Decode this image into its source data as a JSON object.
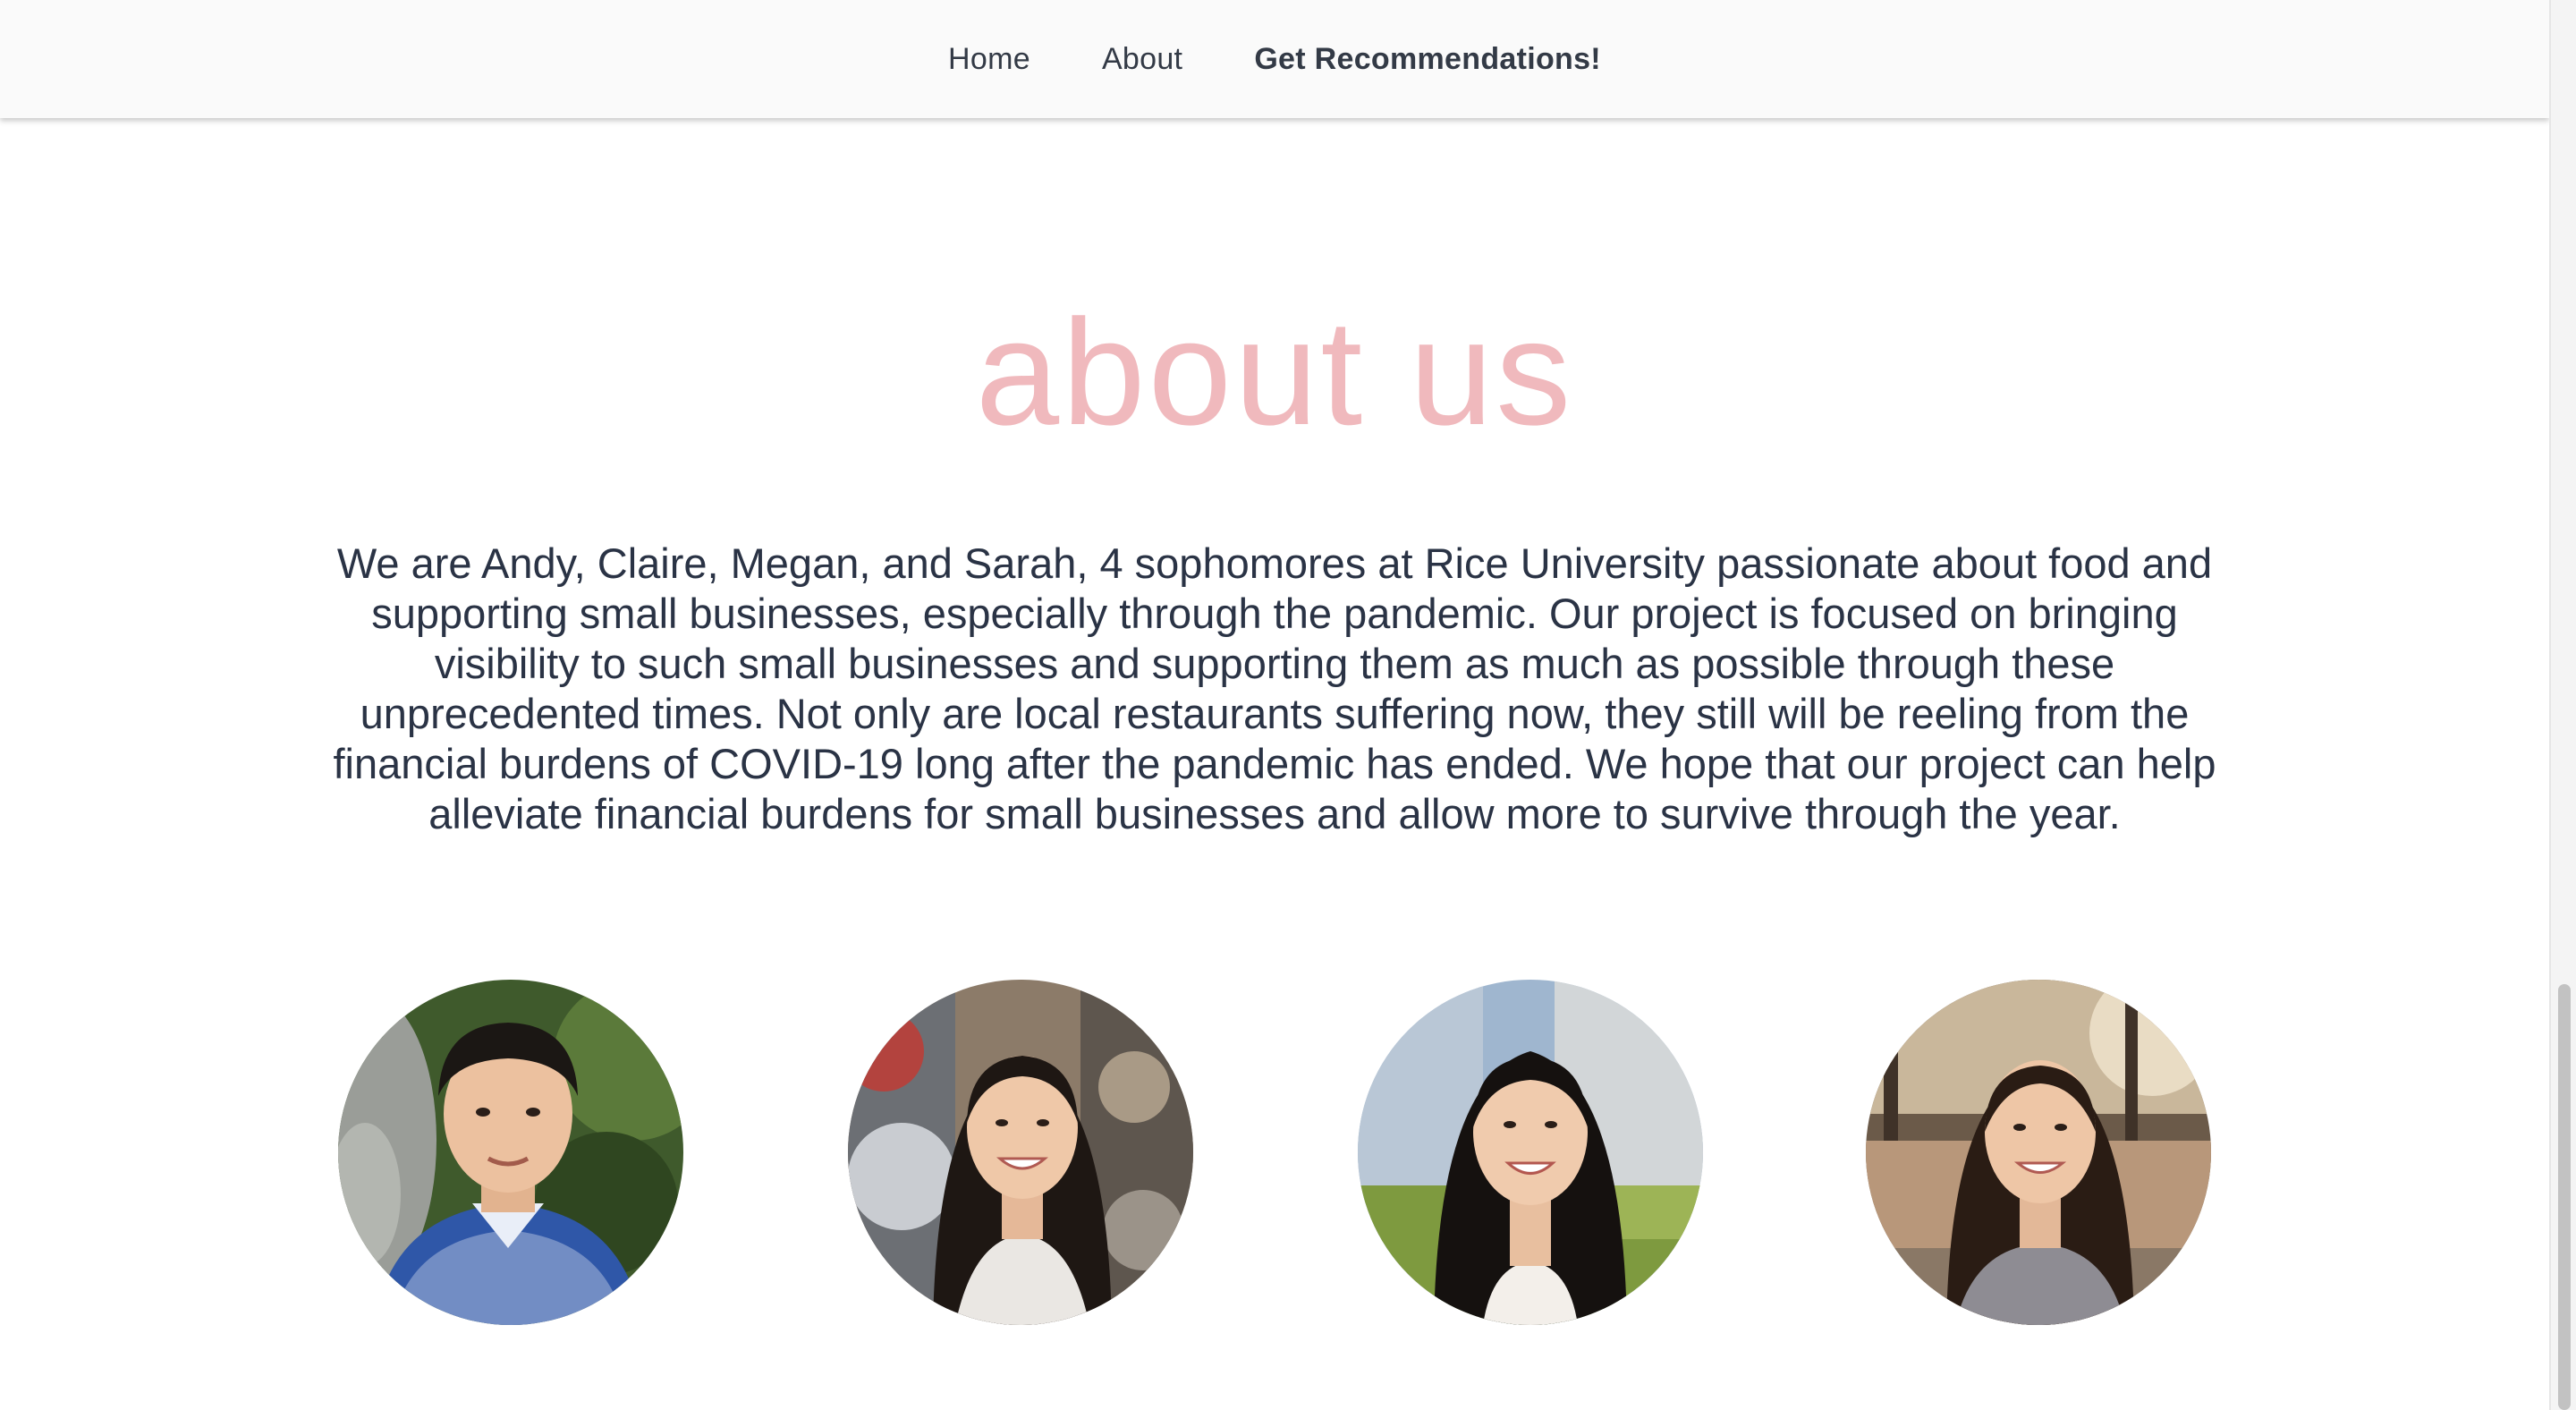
{
  "nav": {
    "home_label": "Home",
    "about_label": "About",
    "recommend_label": "Get Recommendations!"
  },
  "about": {
    "title": "about us",
    "description": "We are Andy, Claire, Megan, and Sarah, 4 sophomores at Rice University passionate about food and supporting small businesses, especially through the pandemic. Our project is focused on bringing visibility to such small businesses and supporting them as much as possible through these unprecedented times. Not only are local restaurants suffering now, they still will be reeling from the financial burdens of COVID-19 long after the pandemic has ended. We hope that our project can help alleviate financial burdens for small businesses and allow more to survive through the year."
  },
  "colors": {
    "title_pink": "#f0b9bd",
    "body_text": "#2a3345",
    "nav_bg": "#fafafa"
  },
  "team": {
    "photos": [
      "team-photo-1",
      "team-photo-2",
      "team-photo-3",
      "team-photo-4"
    ]
  }
}
